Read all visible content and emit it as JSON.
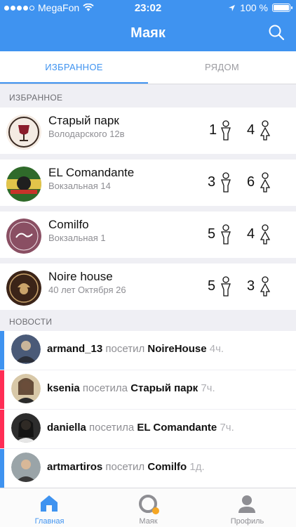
{
  "status_bar": {
    "carrier": "MegaFon",
    "time": "23:02",
    "battery": "100 %"
  },
  "header": {
    "title": "Маяк"
  },
  "tabs": [
    {
      "label": "ИЗБРАННОЕ",
      "active": true
    },
    {
      "label": "РЯДОМ",
      "active": false
    }
  ],
  "favorites": {
    "heading": "ИЗБРАННОЕ",
    "items": [
      {
        "name": "Старый парк",
        "address": "Володарского 12в",
        "men": "1",
        "women": "4"
      },
      {
        "name": "EL Comandante",
        "address": "Вокзальная 14",
        "men": "3",
        "women": "6"
      },
      {
        "name": "Comilfo",
        "address": "Вокзальная 1",
        "men": "5",
        "women": "4"
      },
      {
        "name": "Noire house",
        "address": "40 лет Октября 26",
        "men": "5",
        "women": "3"
      }
    ]
  },
  "news": {
    "heading": "НОВОСТИ",
    "items": [
      {
        "user": "armand_13",
        "action": "посетил",
        "place": "NoireHouse",
        "ago": "4ч.",
        "stripe": "#3f93f0"
      },
      {
        "user": "ksenia",
        "action": "посетила",
        "place": "Старый парк",
        "ago": "7ч.",
        "stripe": "#ff2d55"
      },
      {
        "user": "daniella",
        "action": "посетила",
        "place": "EL Comandante",
        "ago": "7ч.",
        "stripe": "#ff2d55"
      },
      {
        "user": "artmartiros",
        "action": "посетил",
        "place": "Comilfo",
        "ago": "1д.",
        "stripe": "#3f93f0"
      }
    ]
  },
  "tabbar": [
    {
      "label": "Главная",
      "icon": "home-icon",
      "active": true
    },
    {
      "label": "Маяк",
      "icon": "beacon-icon",
      "active": false
    },
    {
      "label": "Профиль",
      "icon": "profile-icon",
      "active": false
    }
  ],
  "colors": {
    "accent": "#3f93f0",
    "female": "#ff2d55",
    "beacon_dot": "#f5a623"
  }
}
